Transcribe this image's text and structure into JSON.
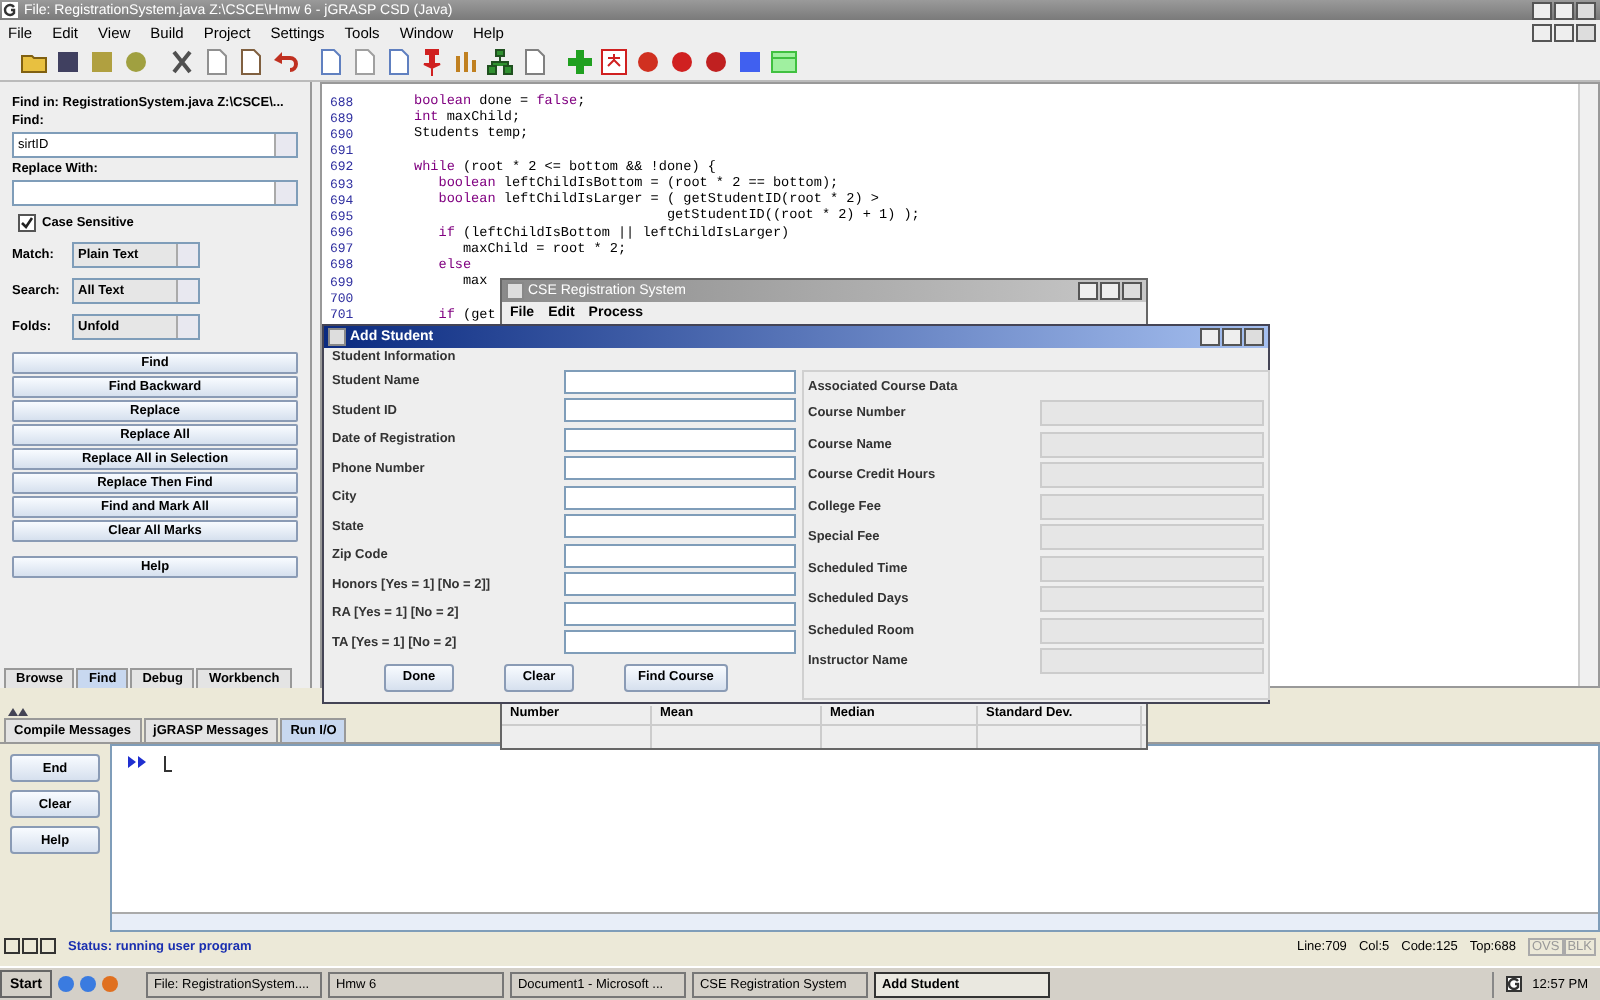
{
  "window": {
    "title": "File: RegistrationSystem.java  Z:\\CSCE\\Hmw 6 - jGRASP CSD (Java)"
  },
  "menu": [
    "File",
    "Edit",
    "View",
    "Build",
    "Project",
    "Settings",
    "Tools",
    "Window",
    "Help"
  ],
  "find_panel": {
    "header": "Find in: RegistrationSystem.java  Z:\\CSCE\\...",
    "find_label": "Find:",
    "find_value": "sirtID",
    "replace_label": "Replace With:",
    "case_sensitive": {
      "label": "Case Sensitive",
      "checked": true
    },
    "options": [
      {
        "label": "Match:",
        "value": "Plain Text"
      },
      {
        "label": "Search:",
        "value": "All Text"
      },
      {
        "label": "Folds:",
        "value": "Unfold"
      }
    ],
    "buttons": [
      "Find",
      "Find Backward",
      "Replace",
      "Replace All",
      "Replace All in Selection",
      "Replace Then Find",
      "Find and Mark All",
      "Clear All Marks"
    ],
    "help": "Help",
    "tabs": [
      {
        "label": "Browse",
        "selected": false
      },
      {
        "label": "Find",
        "selected": true
      },
      {
        "label": "Debug",
        "selected": false
      },
      {
        "label": "Workbench",
        "selected": false
      }
    ]
  },
  "editor": {
    "lines": [
      {
        "number": "688",
        "parts": [
          {
            "text": "boolean",
            "kw": true
          },
          {
            "text": " done = "
          },
          {
            "text": "false",
            "kw": true
          },
          {
            "text": ";"
          }
        ]
      },
      {
        "number": "689",
        "parts": [
          {
            "text": "int",
            "kw": true
          },
          {
            "text": " maxChild;"
          }
        ]
      },
      {
        "number": "690",
        "parts": [
          {
            "text": "Students temp;"
          }
        ]
      },
      {
        "number": "691"
      },
      {
        "number": "692",
        "parts": [
          {
            "text": "while",
            "kw": true
          },
          {
            "text": " (root * 2 <= bottom && !done) {"
          }
        ]
      },
      {
        "number": "693",
        "parts": [
          {
            "text": "   boolean",
            "kw": true
          },
          {
            "text": " leftChildIsBottom = (root * 2 == bottom);"
          }
        ]
      },
      {
        "number": "694",
        "parts": [
          {
            "text": "   boolean",
            "kw": true
          },
          {
            "text": " leftChildIsLarger = ( getStudentID(root * 2) >"
          }
        ]
      },
      {
        "number": "695",
        "parts": [
          {
            "text": "                               getStudentID((root * 2) + 1) );"
          }
        ]
      },
      {
        "number": "696",
        "parts": [
          {
            "text": "   if",
            "kw": true
          },
          {
            "text": " (leftChildIsBottom || leftChildIsLarger)"
          }
        ]
      },
      {
        "number": "697",
        "parts": [
          {
            "text": "      maxChild = root * 2;"
          }
        ]
      },
      {
        "number": "698",
        "parts": [
          {
            "text": "   else",
            "kw": true
          }
        ]
      },
      {
        "number": "699",
        "parts": [
          {
            "text": "      max"
          }
        ]
      },
      {
        "number": "700"
      },
      {
        "number": "701",
        "parts": [
          {
            "text": "   if",
            "kw": true
          },
          {
            "text": " (get"
          }
        ]
      }
    ]
  },
  "cse_window": {
    "title": "CSE Registration System",
    "menu": [
      "File",
      "Edit",
      "Process"
    ],
    "columns": [
      "Number",
      "Mean",
      "Median",
      "Standard Dev."
    ]
  },
  "add_student": {
    "title": "Add Student",
    "student_section": "Student Information",
    "fields": [
      "Student Name",
      "Student ID",
      "Date of Registration",
      "Phone Number",
      "City",
      "State",
      "Zip Code",
      "Honors [Yes = 1] [No = 2]]",
      "RA [Yes = 1] [No = 2]",
      "TA [Yes = 1] [No = 2]"
    ],
    "course_section": "Associated Course Data",
    "course_fields": [
      {
        "label": "Course Number",
        "disabled": true
      },
      {
        "label": "Course Name",
        "disabled": true
      },
      {
        "label": "Course Credit Hours",
        "disabled": true
      },
      {
        "label": "College Fee",
        "disabled": true
      },
      {
        "label": "Special Fee",
        "disabled": true
      },
      {
        "label": "Scheduled Time",
        "disabled": true
      },
      {
        "label": "Scheduled Days",
        "disabled": true
      },
      {
        "label": "Scheduled Room",
        "disabled": true
      },
      {
        "label": "Instructor Name",
        "disabled": true
      }
    ],
    "buttons": [
      "Done",
      "Clear",
      "Find Course"
    ]
  },
  "messages": {
    "tabs": [
      {
        "label": "Compile Messages",
        "selected": false
      },
      {
        "label": "jGRASP Messages",
        "selected": false
      },
      {
        "label": "Run I/O",
        "selected": true
      }
    ],
    "buttons": [
      "End",
      "Clear",
      "Help"
    ]
  },
  "status_bar": {
    "status": "Status: running user program",
    "line": "Line:709",
    "col": "Col:5",
    "code": "Code:125",
    "top": "Top:688",
    "indicators": [
      "OVS",
      "BLK"
    ]
  },
  "taskbar": {
    "start": "Start",
    "items": [
      {
        "label": "File: RegistrationSystem....",
        "selected": false
      },
      {
        "label": "Hmw 6",
        "selected": false
      },
      {
        "label": "Document1 - Microsoft ...",
        "selected": false
      },
      {
        "label": "CSE Registration System",
        "selected": false
      },
      {
        "label": "Add Student",
        "selected": true
      }
    ],
    "clock": "12:57 PM"
  }
}
